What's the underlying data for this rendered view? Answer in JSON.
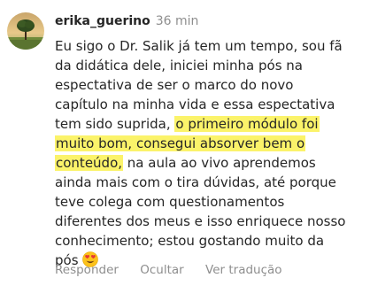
{
  "comment": {
    "username": "erika_guerino",
    "time": "36 min",
    "avatar_icon": "tree-landscape-avatar",
    "text_lines": [
      "Eu sigo o Dr. Salik já tem um tempo, sou fã",
      "da didática dele, iniciei minha pós na",
      "espectativa de ser o marco do novo",
      "capítulo na minha vida e essa espectativa",
      "tem sido suprida,",
      "o primeiro módulo foi",
      "muito bom, consegui absorver bem o",
      "conteúdo,",
      "na aula ao vivo aprendemos",
      "ainda mais com o tira dúvidas, até porque",
      "teve colega com questionamentos",
      "diferentes dos meus e isso enriquece nosso",
      "conhecimento; estou gostando muito da",
      "pós"
    ],
    "emoji_icon": "heart-eyes-emoji",
    "highlight_color": "#fbf36a"
  },
  "actions": {
    "reply": "Responder",
    "hide": "Ocultar",
    "translate": "Ver tradução"
  },
  "colors": {
    "text": "#262626",
    "muted": "#8e8e8e"
  }
}
